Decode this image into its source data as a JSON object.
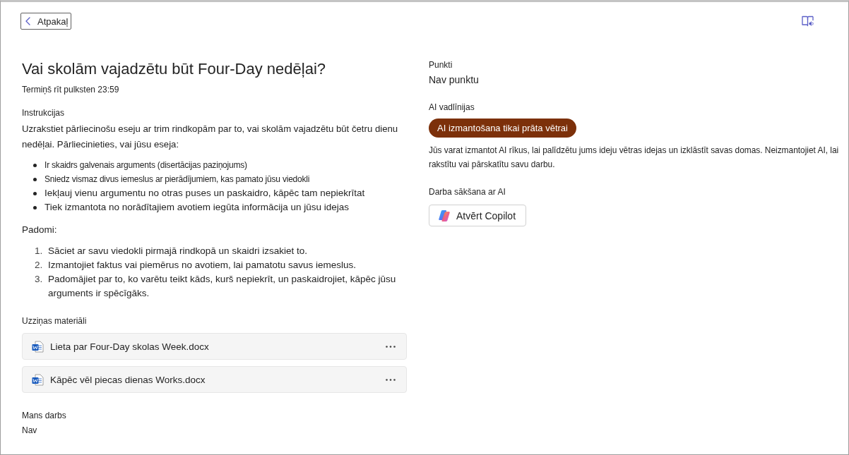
{
  "header": {
    "back_label": "Atpakaļ"
  },
  "assignment": {
    "title": "Vai skolām vajadzētu būt Four-Day nedēļai?",
    "due": "Termiņš rīt pulksten 23:59"
  },
  "instructions": {
    "heading": "Instrukcijas",
    "intro": "Uzrakstiet pārliecinošu eseju ar trim rindkopām par to, vai skolām vajadzētu būt četru dienu nedēļai. Pārliecinieties, vai jūsu eseja:",
    "checklist": [
      "Ir skaidrs galvenais arguments (disertācijas paziņojums)",
      "Sniedz vismaz divus iemeslus ar pierādījumiem, kas pamato jūsu viedokli",
      "Iekļauj vienu argumentu no otras puses un paskaidro, kāpēc tam nepiekrītat",
      "Tiek izmantota no norādītajiem avotiem iegūta informācija un jūsu idejas"
    ],
    "tips_heading": "Padomi:",
    "tips": [
      {
        "number": "1.",
        "text": "Sāciet ar savu viedokli pirmajā rindkopā un skaidri izsakiet to."
      },
      {
        "number": "2.",
        "text": "Izmantojiet faktus vai piemērus no avotiem, lai pamatotu savus iemeslus."
      },
      {
        "number": "3.",
        "text": "Padomājiet par to, ko varētu teikt kāds, kurš nepiekrīt, un paskaidrojiet, kāpēc jūsu arguments ir spēcīgāks."
      }
    ]
  },
  "reference_materials": {
    "heading": "Uzziņas materiāli",
    "files": [
      {
        "name": "Lieta par Four-Day skolas Week.docx"
      },
      {
        "name": "Kāpēc vēl piecas dienas Works.docx"
      }
    ]
  },
  "my_work": {
    "heading": "Mans darbs",
    "value": "Nav"
  },
  "points": {
    "heading": "Punkti",
    "value": "Nav punktu"
  },
  "ai_guidelines": {
    "heading": "AI vadlīnijas",
    "badge": "AI izmantošana tikai prāta vētrai",
    "description": "Jūs varat izmantot AI rīkus, lai palīdzētu jums ideju vētras idejas un izklāstīt savas domas. Neizmantojiet AI, lai rakstītu vai pārskatītu savu darbu."
  },
  "ai_start": {
    "heading": "Darba sākšana ar AI",
    "button": "Atvērt Copilot"
  }
}
